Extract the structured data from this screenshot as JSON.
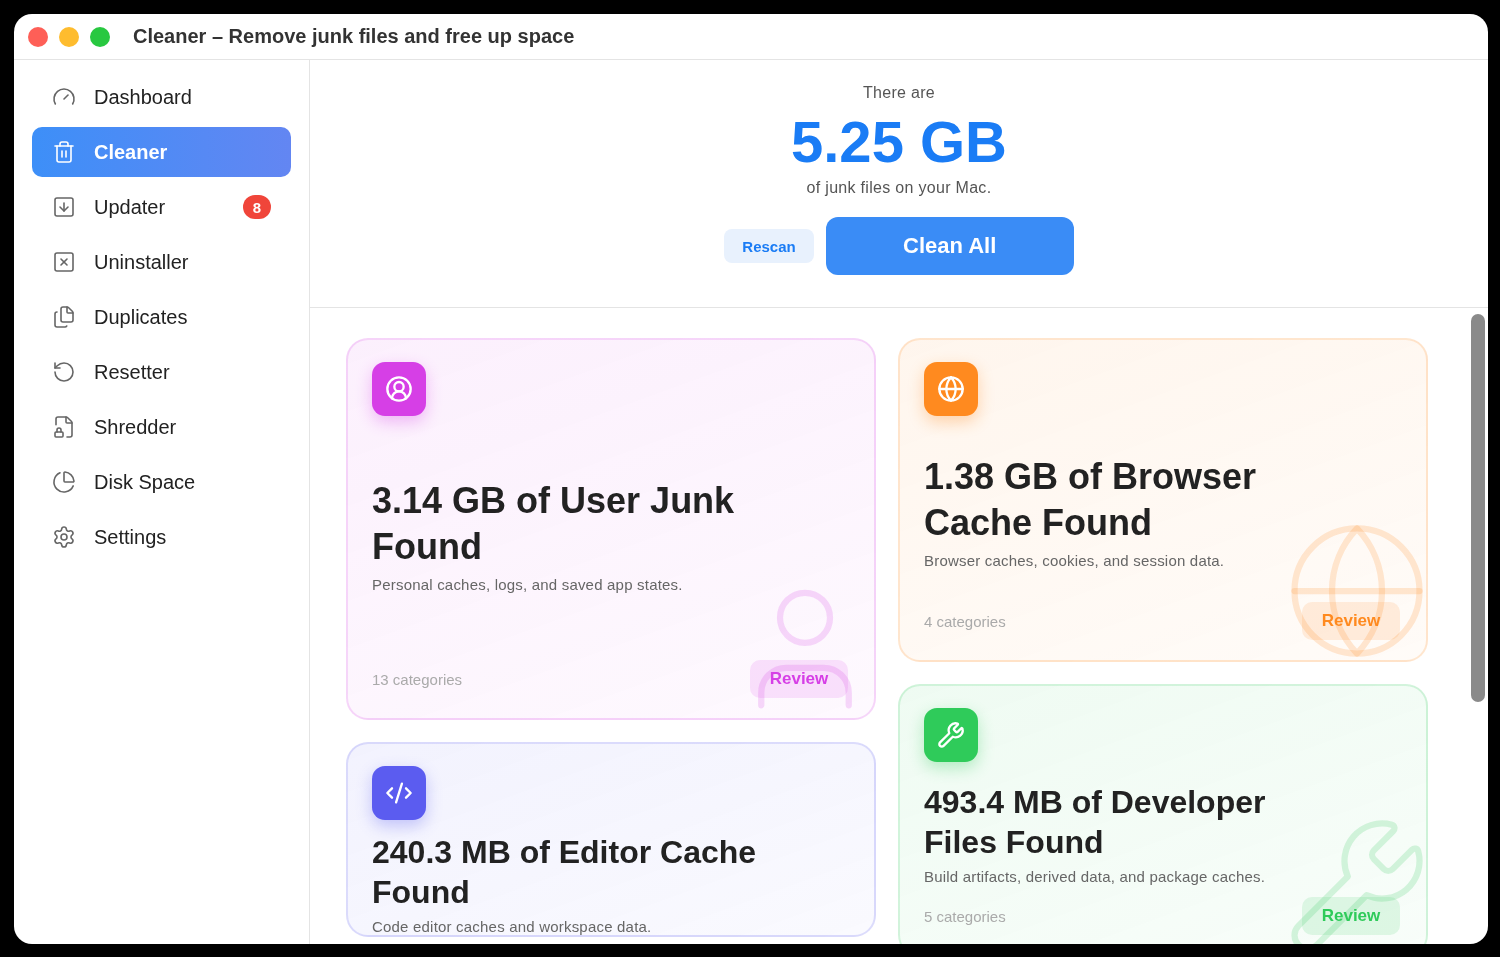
{
  "window": {
    "title": "Cleaner – Remove junk files and free up space"
  },
  "sidebar": {
    "items": [
      {
        "label": "Dashboard",
        "selected": false
      },
      {
        "label": "Cleaner",
        "selected": true
      },
      {
        "label": "Updater",
        "selected": false,
        "badge": "8"
      },
      {
        "label": "Uninstaller",
        "selected": false
      },
      {
        "label": "Duplicates",
        "selected": false
      },
      {
        "label": "Resetter",
        "selected": false
      },
      {
        "label": "Shredder",
        "selected": false
      },
      {
        "label": "Disk Space",
        "selected": false
      },
      {
        "label": "Settings",
        "selected": false
      }
    ]
  },
  "summary": {
    "prefix": "There are",
    "total": "5.25 GB",
    "suffix": "of junk files on your Mac.",
    "rescan": "Rescan",
    "clean": "Clean All"
  },
  "cards": [
    {
      "color": "#d63fe6",
      "title": "3.14 GB of User Junk Found",
      "description": "Personal caches, logs, and saved app states.",
      "categories": "13 categories",
      "action": "Review"
    },
    {
      "color": "#ff8a1f",
      "title": "1.38 GB of Browser Cache Found",
      "description": "Browser caches, cookies, and session data.",
      "categories": "4 categories",
      "action": "Review"
    },
    {
      "color": "#5b5cf0",
      "title": "240.3 MB of Editor Cache Found",
      "description": "Code editor caches and workspace data."
    },
    {
      "color": "#2fcb5a",
      "title": "493.4 MB of Developer Files Found",
      "description": "Build artifacts, derived data, and package caches.",
      "categories": "5 categories",
      "action": "Review"
    }
  ]
}
